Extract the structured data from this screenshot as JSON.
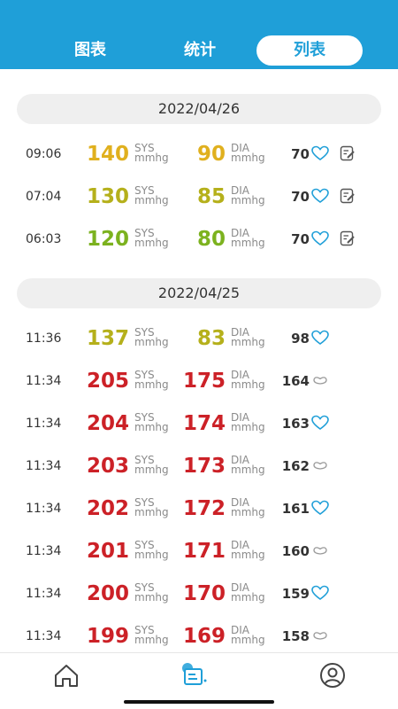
{
  "tabs": [
    {
      "label": "图表"
    },
    {
      "label": "统计"
    },
    {
      "label": "列表"
    }
  ],
  "units": {
    "sys": "SYS",
    "dia": "DIA",
    "mmhg": "mmhg"
  },
  "colors": {
    "accent": "#1f9fd8",
    "high": "#cc2127",
    "elevated": "#e0b01e",
    "slightly_high": "#b5b01b",
    "normal": "#7cb21f"
  },
  "groups": [
    {
      "date": "2022/04/26",
      "rows": [
        {
          "time": "09:06",
          "sys": "140",
          "dia": "90",
          "pulse": "70",
          "sys_color": "#e0b01e",
          "dia_color": "#e0b01e",
          "heart": "heart-icon"
        },
        {
          "time": "07:04",
          "sys": "130",
          "dia": "85",
          "pulse": "70",
          "sys_color": "#b5b01b",
          "dia_color": "#b5b01b",
          "heart": "heart-icon"
        },
        {
          "time": "06:03",
          "sys": "120",
          "dia": "80",
          "pulse": "70",
          "sys_color": "#7cb21f",
          "dia_color": "#7cb21f",
          "heart": "heart-icon"
        }
      ]
    },
    {
      "date": "2022/04/25",
      "rows": [
        {
          "time": "11:36",
          "sys": "137",
          "dia": "83",
          "pulse": "98",
          "sys_color": "#b5b01b",
          "dia_color": "#b5b01b",
          "heart": "heart-icon"
        },
        {
          "time": "11:34",
          "sys": "205",
          "dia": "175",
          "pulse": "164",
          "sys_color": "#cc2127",
          "dia_color": "#cc2127",
          "heart": "heart-flat-icon"
        },
        {
          "time": "11:34",
          "sys": "204",
          "dia": "174",
          "pulse": "163",
          "sys_color": "#cc2127",
          "dia_color": "#cc2127",
          "heart": "heart-icon"
        },
        {
          "time": "11:34",
          "sys": "203",
          "dia": "173",
          "pulse": "162",
          "sys_color": "#cc2127",
          "dia_color": "#cc2127",
          "heart": "heart-flat-icon"
        },
        {
          "time": "11:34",
          "sys": "202",
          "dia": "172",
          "pulse": "161",
          "sys_color": "#cc2127",
          "dia_color": "#cc2127",
          "heart": "heart-icon"
        },
        {
          "time": "11:34",
          "sys": "201",
          "dia": "171",
          "pulse": "160",
          "sys_color": "#cc2127",
          "dia_color": "#cc2127",
          "heart": "heart-flat-icon"
        },
        {
          "time": "11:34",
          "sys": "200",
          "dia": "170",
          "pulse": "159",
          "sys_color": "#cc2127",
          "dia_color": "#cc2127",
          "heart": "heart-icon"
        },
        {
          "time": "11:34",
          "sys": "199",
          "dia": "169",
          "pulse": "158",
          "sys_color": "#cc2127",
          "dia_color": "#cc2127",
          "heart": "heart-flat-icon"
        }
      ]
    }
  ],
  "nav": [
    {
      "icon": "home-icon"
    },
    {
      "icon": "list-icon"
    },
    {
      "icon": "user-icon"
    }
  ]
}
